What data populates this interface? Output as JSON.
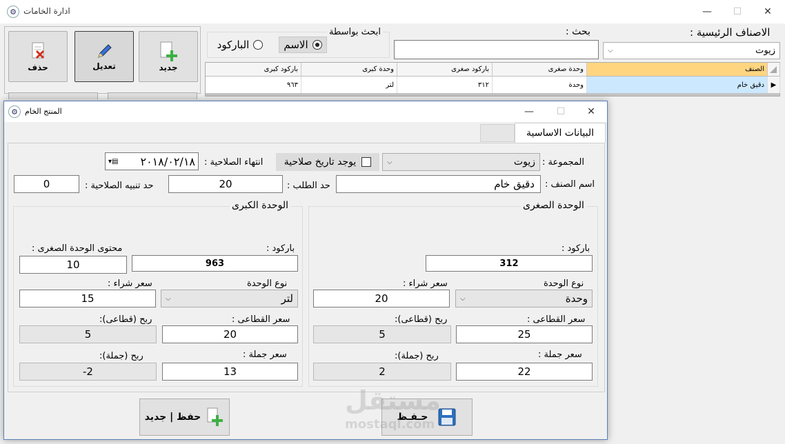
{
  "main_window": {
    "title": "ادارة الخامات",
    "minimize": "—",
    "maximize": "☐",
    "close": "✕",
    "toolbar": {
      "new": "جديد",
      "edit": "تعديل",
      "delete": "حذف"
    },
    "search_by": {
      "label": "ابحث بواسطة",
      "name_option": "الاسم",
      "barcode_option": "الباركود",
      "selected": "الاسم"
    },
    "search": {
      "label": "بحث :",
      "value": ""
    },
    "category": {
      "label": "الاصناف الرئيسية :",
      "value": "زيوت"
    },
    "grid": {
      "columns": [
        "الصنف",
        "وحدة صغرى",
        "باركود صغرى",
        "وحدة كبرى",
        "باركود كبرى"
      ],
      "rows": [
        [
          "دقيق خام",
          "وحدة",
          "٣١٢",
          "لتر",
          "٩٦٣"
        ]
      ]
    }
  },
  "dialog": {
    "title": "المنتج الخام",
    "tab_basic": "البيانات الاساسية",
    "group_label": "المجموعة :",
    "group_value": "زيوت",
    "has_expiry_label": "يوجد تاريخ صلاحية",
    "has_expiry_checked": false,
    "expiry_end_label": "انتهاء الصلاحية :",
    "expiry_date": "٢٠١٨/٠٢/١٨",
    "item_name_label": "اسم الصنف :",
    "item_name": "دقيق خام",
    "reorder_label": "حد الطلب :",
    "reorder_value": "20",
    "expiry_alert_label": "حد تنبيه الصلاحية :",
    "expiry_alert_value": "0",
    "small_unit": {
      "title": "الوحدة الصغرى",
      "barcode_label": "باركود :",
      "barcode": "312",
      "unit_type_label": "نوع الوحدة",
      "unit_type": "وحدة",
      "purchase_label": "سعر شراء :",
      "purchase": "20",
      "retail_label": "سعر القطاعى :",
      "retail": "25",
      "retail_profit_label": "ربح (قطاعى):",
      "retail_profit": "5",
      "wholesale_label": "سعر جملة :",
      "wholesale": "22",
      "wholesale_profit_label": "ربح (جملة):",
      "wholesale_profit": "2"
    },
    "large_unit": {
      "title": "الوحدة الكبرى",
      "barcode_label": "باركود :",
      "barcode": "963",
      "content_label": "محتوى الوحدة الصغرى :",
      "content": "10",
      "unit_type_label": "نوع الوحدة",
      "unit_type": "لتر",
      "purchase_label": "سعر شراء :",
      "purchase": "15",
      "retail_label": "سعر القطاعى :",
      "retail": "20",
      "retail_profit_label": "ربح (قطاعى):",
      "retail_profit": "5",
      "wholesale_label": "سعر جملة :",
      "wholesale": "13",
      "wholesale_profit_label": "ربح (جملة):",
      "wholesale_profit": "-2"
    },
    "save_button": "حـفـظ",
    "save_new_button": "حفظ | جديد"
  },
  "watermark": {
    "arabic": "مستقل",
    "latin": "mostaql.com"
  },
  "colors": {
    "grid_selected": "#ffd580",
    "grid_row_selected": "#cce8ff",
    "dialog_border": "#5a7fb5",
    "plus_green": "#3cb043",
    "delete_red": "#d03020"
  }
}
